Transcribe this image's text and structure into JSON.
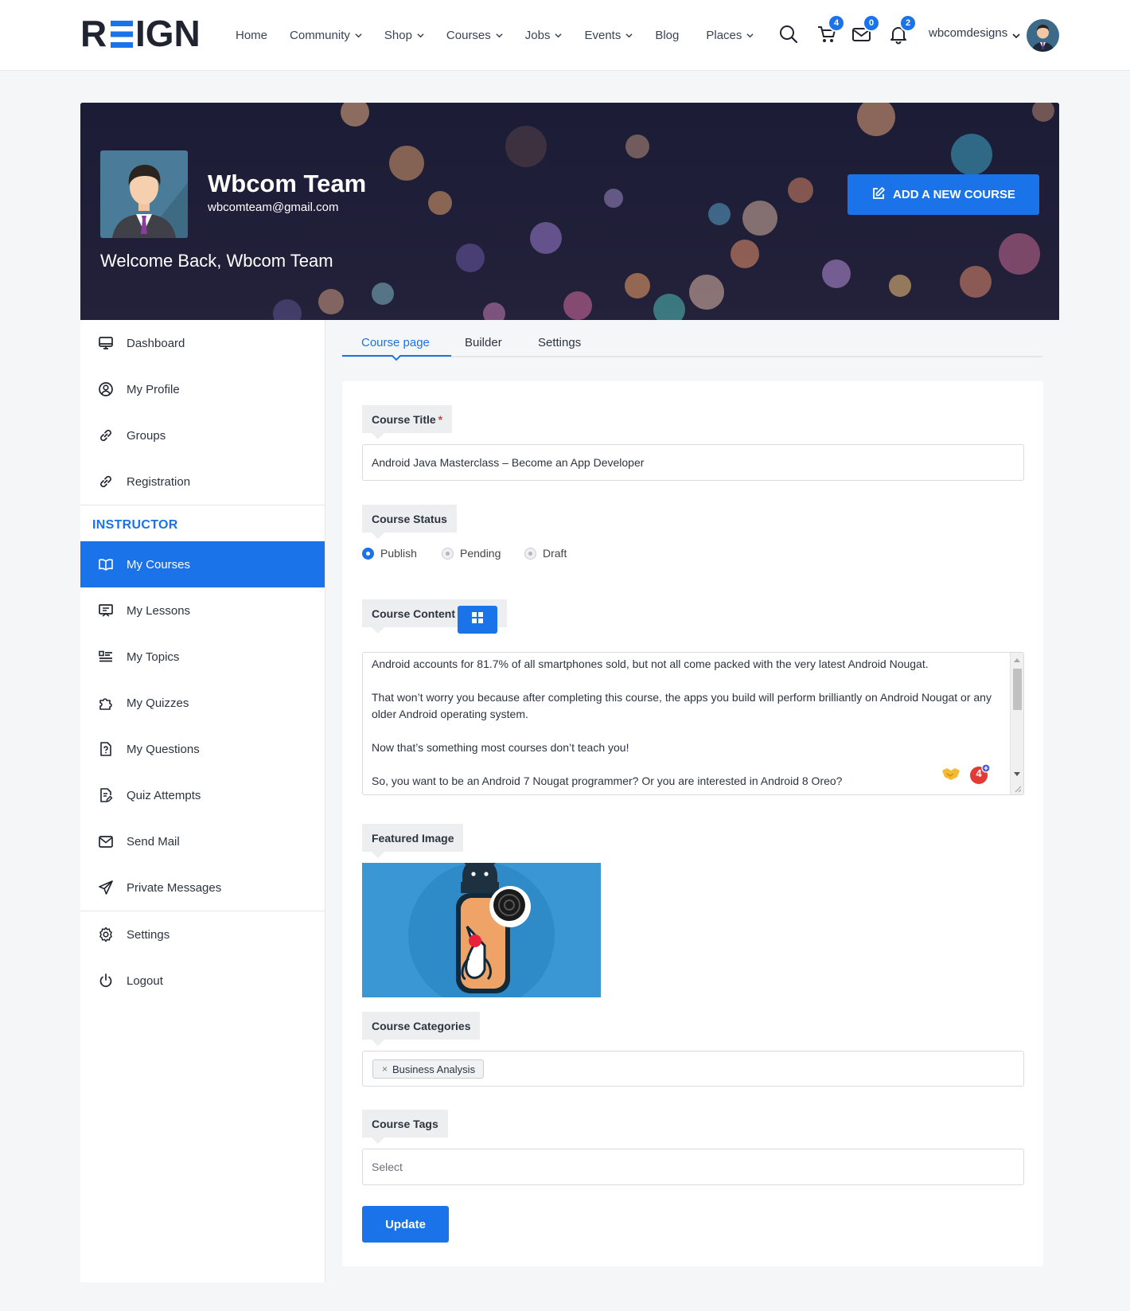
{
  "header": {
    "logo_text": "REIGN",
    "nav": [
      {
        "label": "Home",
        "has_dropdown": false
      },
      {
        "label": "Community",
        "has_dropdown": true
      },
      {
        "label": "Shop",
        "has_dropdown": true
      },
      {
        "label": "Courses",
        "has_dropdown": true
      },
      {
        "label": "Jobs",
        "has_dropdown": true
      },
      {
        "label": "Events",
        "has_dropdown": true
      },
      {
        "label": "Blog",
        "has_dropdown": false
      },
      {
        "label": "Places",
        "has_dropdown": true
      }
    ],
    "icons": {
      "search": "search-icon",
      "cart": {
        "icon": "cart-icon",
        "count": "4"
      },
      "messages": {
        "icon": "envelope-icon",
        "count": "0"
      },
      "notifications": {
        "icon": "bell-icon",
        "count": "2"
      }
    },
    "username": "wbcomdesigns"
  },
  "banner": {
    "name": "Wbcom Team",
    "email": "wbcomteam@gmail.com",
    "welcome": "Welcome Back, Wbcom Team",
    "add_course_label": "ADD A NEW COURSE"
  },
  "sidebar": {
    "items": [
      {
        "label": "Dashboard",
        "icon": "monitor-icon"
      },
      {
        "label": "My Profile",
        "icon": "user-circle-icon"
      },
      {
        "label": "Groups",
        "icon": "link-icon"
      },
      {
        "label": "Registration",
        "icon": "link-icon"
      }
    ],
    "instructor_heading": "INSTRUCTOR",
    "instructor_items": [
      {
        "label": "My Courses",
        "icon": "book-icon",
        "active": true
      },
      {
        "label": "My Lessons",
        "icon": "presentation-icon"
      },
      {
        "label": "My Topics",
        "icon": "list-icon"
      },
      {
        "label": "My Quizzes",
        "icon": "puzzle-icon"
      },
      {
        "label": "My Questions",
        "icon": "question-file-icon"
      },
      {
        "label": "Quiz Attempts",
        "icon": "file-edit-icon"
      },
      {
        "label": "Send Mail",
        "icon": "mail-icon"
      },
      {
        "label": "Private Messages",
        "icon": "paper-plane-icon"
      }
    ],
    "bottom_items": [
      {
        "label": "Settings",
        "icon": "gear-icon"
      },
      {
        "label": "Logout",
        "icon": "power-icon"
      }
    ]
  },
  "tabs": [
    {
      "label": "Course page",
      "active": true
    },
    {
      "label": "Builder",
      "active": false
    },
    {
      "label": "Settings",
      "active": false
    }
  ],
  "form": {
    "title_label": "Course Title",
    "title_required": "*",
    "title_value": "Android Java Masterclass – Become an App Developer",
    "status_label": "Course Status",
    "status_options": [
      "Publish",
      "Pending",
      "Draft"
    ],
    "status_selected": "Publish",
    "content_label": "Course Content",
    "content_paragraphs": [
      "Android accounts for 81.7% of all smartphones sold, but not all come packed with the very latest Android Nougat.",
      "That won’t worry you because after completing this course, the apps you build will perform brilliantly on Android Nougat or any older Android operating system.",
      "Now that’s something most courses don’t teach you!",
      "So, you want to be an Android 7 Nougat programmer?  Or you are interested in Android 8 Oreo?"
    ],
    "grammar_count": "4",
    "featured_image_label": "Featured Image",
    "categories_label": "Course Categories",
    "categories": [
      {
        "label": "Business Analysis",
        "remove": "×"
      }
    ],
    "tags_label": "Course Tags",
    "tags_placeholder": "Select",
    "update_label": "Update"
  },
  "colors": {
    "accent": "#1a73e8",
    "banner_bg": "#1a1d33",
    "page_bg": "#f5f6f7"
  }
}
